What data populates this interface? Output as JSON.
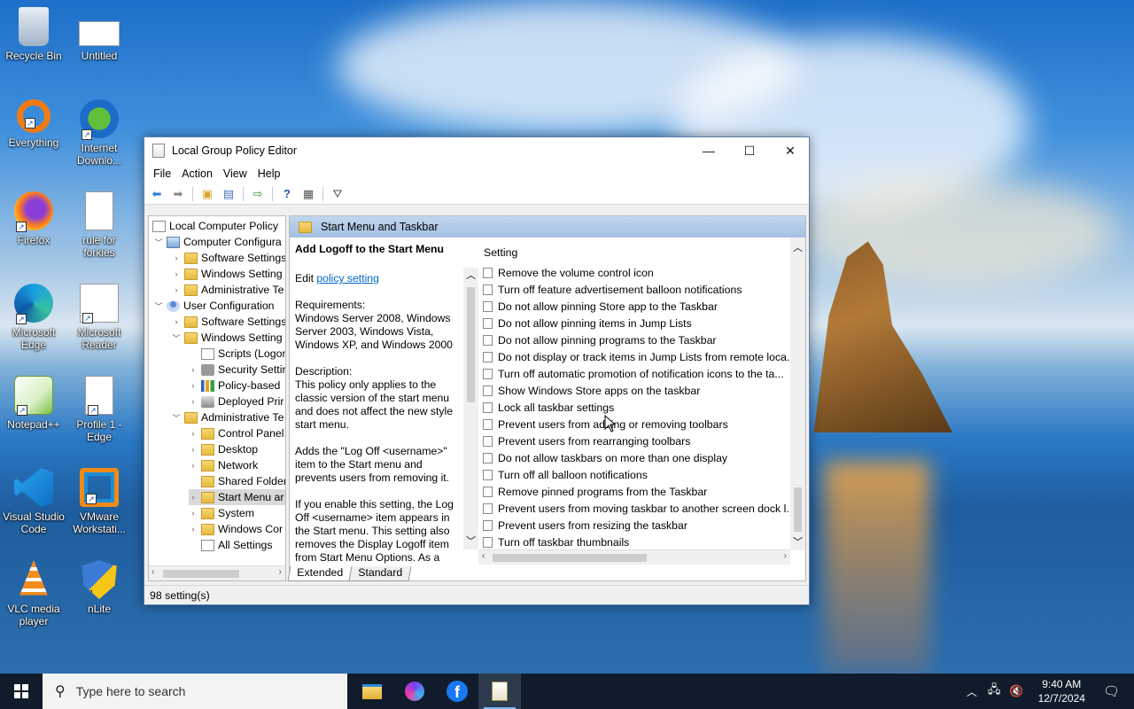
{
  "desktop": {
    "icons": [
      {
        "label": "Recycle Bin"
      },
      {
        "label": "Untitled"
      },
      {
        "label": "Everything"
      },
      {
        "label": "Internet Downlo..."
      },
      {
        "label": "Firefox"
      },
      {
        "label": "rule for forkies"
      },
      {
        "label": "Microsoft Edge"
      },
      {
        "label": "Microsoft Reader"
      },
      {
        "label": "Notepad++"
      },
      {
        "label": "Profile 1 - Edge"
      },
      {
        "label": "Visual Studio Code"
      },
      {
        "label": "VMware Workstati..."
      },
      {
        "label": "VLC media player"
      },
      {
        "label": "nLite"
      }
    ]
  },
  "window": {
    "title": "Local Group Policy Editor",
    "minimize": "—",
    "maximize": "☐",
    "close": "✕",
    "menu": [
      "File",
      "Action",
      "View",
      "Help"
    ],
    "tree": [
      {
        "label": "Local Computer Policy",
        "icon": "policy-icon"
      },
      {
        "label": "Computer Configura",
        "icon": "computer-icon"
      },
      {
        "label": "Software Settings",
        "icon": "folder-icon"
      },
      {
        "label": "Windows Setting",
        "icon": "folder-icon"
      },
      {
        "label": "Administrative Te",
        "icon": "folder-icon"
      },
      {
        "label": "User Configuration",
        "icon": "user-icon"
      },
      {
        "label": "Software Settings",
        "icon": "folder-icon"
      },
      {
        "label": "Windows Setting",
        "icon": "folder-icon"
      },
      {
        "label": "Scripts (Logon",
        "icon": "script-icon"
      },
      {
        "label": "Security Settir",
        "icon": "security-icon"
      },
      {
        "label": "Policy-based",
        "icon": "chart-icon"
      },
      {
        "label": "Deployed Prir",
        "icon": "printer-icon"
      },
      {
        "label": "Administrative Te",
        "icon": "folder-icon"
      },
      {
        "label": "Control Panel",
        "icon": "folder-icon"
      },
      {
        "label": "Desktop",
        "icon": "folder-icon"
      },
      {
        "label": "Network",
        "icon": "folder-icon"
      },
      {
        "label": "Shared Folder",
        "icon": "folder-icon"
      },
      {
        "label": "Start Menu ar",
        "icon": "folder-icon"
      },
      {
        "label": "System",
        "icon": "folder-icon"
      },
      {
        "label": "Windows Cor",
        "icon": "folder-icon"
      },
      {
        "label": "All Settings",
        "icon": "settings-icon"
      }
    ],
    "panel_header": "Start Menu and Taskbar",
    "description": {
      "title": "Add Logoff to the Start Menu",
      "edit_prefix": "Edit ",
      "edit_link": "policy setting",
      "requirements_label": "Requirements:",
      "requirements": "Windows Server 2008, Windows Server 2003, Windows Vista, Windows XP, and Windows 2000",
      "description_label": "Description:",
      "description": "This policy only applies to the classic version of the start menu and does not affect the new style start menu.",
      "para2": "Adds the \"Log Off <username>\" item to the Start menu and prevents users from removing it.",
      "para3": "If you enable this setting, the Log Off <username> item appears in the Start menu. This setting also removes the Display Logoff item from Start Menu Options. As a"
    },
    "list_header": "Setting",
    "settings": [
      "Remove the volume control icon",
      "Turn off feature advertisement balloon notifications",
      "Do not allow pinning Store app to the Taskbar",
      "Do not allow pinning items in Jump Lists",
      "Do not allow pinning programs to the Taskbar",
      "Do not display or track items in Jump Lists from remote loca...",
      "Turn off automatic promotion of notification icons to the ta...",
      "Show Windows Store apps on the taskbar",
      "Lock all taskbar settings",
      "Prevent users from adding or removing toolbars",
      "Prevent users from rearranging toolbars",
      "Do not allow taskbars on more than one display",
      "Turn off all balloon notifications",
      "Remove pinned programs from the Taskbar",
      "Prevent users from moving taskbar to another screen dock l...",
      "Prevent users from resizing the taskbar",
      "Turn off taskbar thumbnails"
    ],
    "tabs": [
      "Extended",
      "Standard"
    ],
    "status": "98 setting(s)"
  },
  "taskbar": {
    "search_placeholder": "Type here to search",
    "time": "9:40 AM",
    "date": "12/7/2024"
  }
}
